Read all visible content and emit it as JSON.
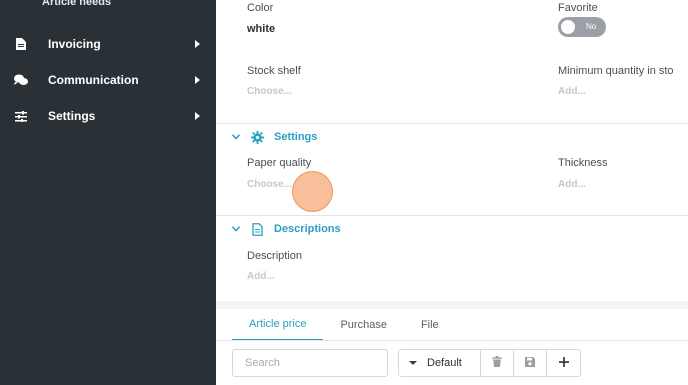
{
  "sidebar": {
    "top_item": "Article needs",
    "items": [
      {
        "label": "Invoicing",
        "icon": "invoice-icon"
      },
      {
        "label": "Communication",
        "icon": "chat-bubbles-icon"
      },
      {
        "label": "Settings",
        "icon": "sliders-icon"
      }
    ]
  },
  "fields": {
    "color_label": "Color",
    "color_value": "white",
    "favorite_label": "Favorite",
    "favorite_toggle": "No",
    "stock_shelf_label": "Stock shelf",
    "stock_shelf_placeholder": "Choose...",
    "min_qty_label": "Minimum quantity in sto",
    "min_qty_placeholder": "Add..."
  },
  "settings_section": {
    "title": "Settings",
    "icon": "gear-icon",
    "paper_quality_label": "Paper quality",
    "paper_quality_placeholder": "Choose...",
    "thickness_label": "Thickness",
    "thickness_placeholder": "Add..."
  },
  "descriptions_section": {
    "title": "Descriptions",
    "icon": "document-icon",
    "description_label": "Description",
    "description_placeholder": "Add..."
  },
  "tabs": [
    {
      "label": "Article price",
      "active": true
    },
    {
      "label": "Purchase",
      "active": false
    },
    {
      "label": "File",
      "active": false
    }
  ],
  "toolbar": {
    "search_placeholder": "Search",
    "default_label": "Default"
  },
  "colors": {
    "accent": "#2a9fc4",
    "sidebar_bg": "#2a3136"
  }
}
